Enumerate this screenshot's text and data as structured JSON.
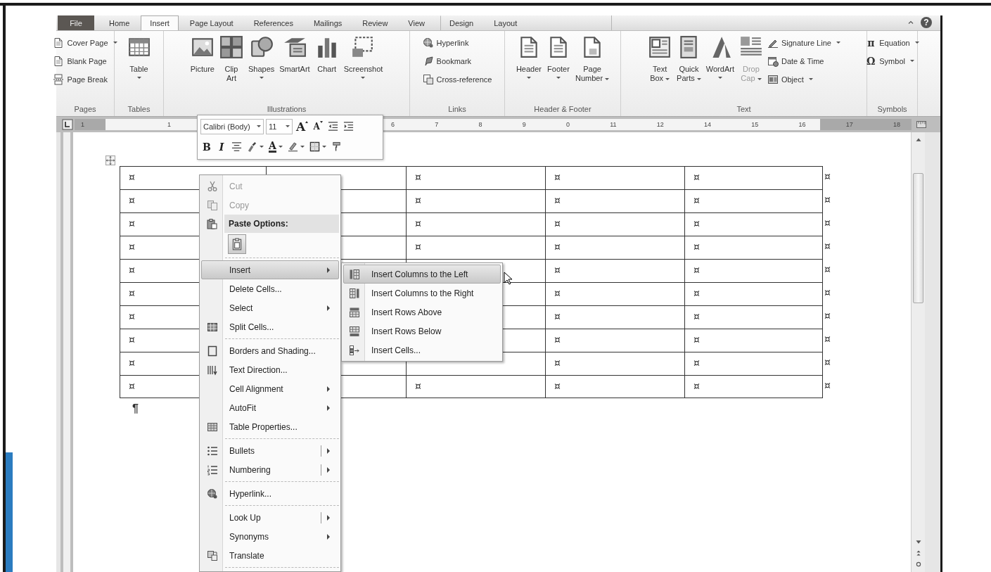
{
  "tabs": [
    {
      "label": "File",
      "kind": "file",
      "selected": false
    },
    {
      "label": "Home",
      "kind": "normal",
      "selected": false
    },
    {
      "label": "Insert",
      "kind": "normal",
      "selected": true
    },
    {
      "label": "Page Layout",
      "kind": "normal",
      "selected": false
    },
    {
      "label": "References",
      "kind": "normal",
      "selected": false
    },
    {
      "label": "Mailings",
      "kind": "normal",
      "selected": false
    },
    {
      "label": "Review",
      "kind": "normal",
      "selected": false
    },
    {
      "label": "View",
      "kind": "normal",
      "selected": false
    },
    {
      "label": "Design",
      "kind": "contextual",
      "selected": false
    },
    {
      "label": "Layout",
      "kind": "contextual",
      "selected": false
    }
  ],
  "help": "?",
  "ribbon_groups": [
    {
      "label": "Pages",
      "items": [
        {
          "kind": "small",
          "label": "Cover Page",
          "dropdown": true,
          "disabled": false
        },
        {
          "kind": "small",
          "label": "Blank Page",
          "dropdown": false,
          "disabled": false
        },
        {
          "kind": "small",
          "label": "Page Break",
          "dropdown": false,
          "disabled": false
        }
      ]
    },
    {
      "label": "Tables",
      "items": [
        {
          "kind": "large",
          "label": "Table",
          "dropdown": true,
          "disabled": false
        }
      ]
    },
    {
      "label": "Illustrations",
      "items": [
        {
          "kind": "large",
          "label": "Picture",
          "dropdown": false,
          "disabled": false
        },
        {
          "kind": "large",
          "label": "Clip\nArt",
          "dropdown": false,
          "disabled": false
        },
        {
          "kind": "large",
          "label": "Shapes",
          "dropdown": true,
          "disabled": false
        },
        {
          "kind": "large",
          "label": "SmartArt",
          "dropdown": false,
          "disabled": false
        },
        {
          "kind": "large",
          "label": "Chart",
          "dropdown": false,
          "disabled": false
        },
        {
          "kind": "large",
          "label": "Screenshot",
          "dropdown": true,
          "disabled": false
        }
      ]
    },
    {
      "label": "Links",
      "items": [
        {
          "kind": "small",
          "label": "Hyperlink",
          "dropdown": false,
          "disabled": false
        },
        {
          "kind": "small",
          "label": "Bookmark",
          "dropdown": false,
          "disabled": false
        },
        {
          "kind": "small",
          "label": "Cross-reference",
          "dropdown": false,
          "disabled": false
        }
      ]
    },
    {
      "label": "Header & Footer",
      "items": [
        {
          "kind": "large",
          "label": "Header",
          "dropdown": true,
          "disabled": false
        },
        {
          "kind": "large",
          "label": "Footer",
          "dropdown": true,
          "disabled": false
        },
        {
          "kind": "large",
          "label": "Page\nNumber",
          "dropdown": true,
          "disabled": false
        }
      ]
    },
    {
      "label": "Text",
      "items": [
        {
          "kind": "large",
          "label": "Text\nBox",
          "dropdown": true,
          "disabled": false
        },
        {
          "kind": "large",
          "label": "Quick\nParts",
          "dropdown": true,
          "disabled": false
        },
        {
          "kind": "large",
          "label": "WordArt",
          "dropdown": true,
          "disabled": false
        },
        {
          "kind": "large",
          "label": "Drop\nCap",
          "dropdown": true,
          "disabled": true
        },
        {
          "kind": "small",
          "label": "Signature Line",
          "dropdown": true,
          "disabled": false
        },
        {
          "kind": "small",
          "label": "Date & Time",
          "dropdown": false,
          "disabled": false
        },
        {
          "kind": "small",
          "label": "Object",
          "dropdown": true,
          "disabled": false
        }
      ]
    },
    {
      "label": "Symbols",
      "items": [
        {
          "kind": "small",
          "glyph": "π",
          "label": "Equation",
          "dropdown": true,
          "disabled": false
        },
        {
          "kind": "small",
          "glyph": "Ω",
          "label": "Symbol",
          "dropdown": true,
          "disabled": false
        }
      ]
    }
  ],
  "ruler": {
    "left_numbers": [
      "1",
      "1"
    ],
    "right_numbers": [
      "6",
      "7",
      "8",
      "9",
      "0",
      "11",
      "12",
      "14",
      "15",
      "16",
      "17",
      "18"
    ]
  },
  "mini_toolbar": {
    "font": "Calibri (Body)",
    "size": "11",
    "row1": [
      {
        "kind": "grow",
        "label": "A"
      },
      {
        "kind": "shrink",
        "label": "A"
      },
      {
        "kind": "outdent"
      },
      {
        "kind": "indent"
      }
    ],
    "row2": [
      {
        "kind": "bold",
        "label": "B"
      },
      {
        "kind": "italic",
        "label": "I"
      },
      {
        "kind": "center"
      },
      {
        "kind": "styles"
      },
      {
        "kind": "font_color",
        "label": "A"
      },
      {
        "kind": "highlight"
      },
      {
        "kind": "borders"
      },
      {
        "kind": "painter"
      }
    ]
  },
  "table": {
    "rows": [
      {
        "cells": [
          "¤",
          null,
          "¤",
          "¤",
          "¤"
        ],
        "end": "¤"
      },
      {
        "cells": [
          "¤",
          null,
          "¤",
          "¤",
          "¤"
        ],
        "end": "¤"
      },
      {
        "cells": [
          "¤",
          null,
          "¤",
          "¤",
          "¤"
        ],
        "end": "¤"
      },
      {
        "cells": [
          "¤",
          null,
          "¤",
          "¤",
          "¤"
        ],
        "end": "¤"
      },
      {
        "cells": [
          "¤",
          null,
          null,
          "¤",
          "¤"
        ],
        "end": "¤"
      },
      {
        "cells": [
          "¤",
          null,
          null,
          "¤",
          "¤"
        ],
        "end": "¤"
      },
      {
        "cells": [
          "¤",
          null,
          null,
          "¤",
          "¤"
        ],
        "end": "¤"
      },
      {
        "cells": [
          "¤",
          null,
          null,
          "¤",
          "¤"
        ],
        "end": "¤"
      },
      {
        "cells": [
          "¤",
          null,
          null,
          "¤",
          "¤"
        ],
        "end": "¤"
      },
      {
        "cells": [
          "¤",
          null,
          "¤",
          "¤",
          "¤"
        ],
        "end": "¤"
      }
    ]
  },
  "paragraph_mark": "¶",
  "context_menu": [
    {
      "kind": "item",
      "label": "Cut",
      "disabled": true,
      "selected": false,
      "submenu": false,
      "split": false
    },
    {
      "kind": "item",
      "label": "Copy",
      "disabled": true,
      "selected": false,
      "submenu": false,
      "split": false
    },
    {
      "kind": "header",
      "label": "Paste Options:"
    },
    {
      "kind": "paste_options"
    },
    {
      "kind": "separator"
    },
    {
      "kind": "item",
      "label": "Insert",
      "disabled": false,
      "selected": true,
      "submenu": true,
      "split": false
    },
    {
      "kind": "item",
      "label": "Delete Cells...",
      "disabled": false,
      "selected": false,
      "submenu": false,
      "split": false
    },
    {
      "kind": "item",
      "label": "Select",
      "disabled": false,
      "selected": false,
      "submenu": true,
      "split": false
    },
    {
      "kind": "item",
      "label": "Split Cells...",
      "disabled": false,
      "selected": false,
      "submenu": false,
      "split": false
    },
    {
      "kind": "separator"
    },
    {
      "kind": "item",
      "label": "Borders and Shading...",
      "disabled": false,
      "selected": false,
      "submenu": false,
      "split": false
    },
    {
      "kind": "item",
      "label": "Text Direction...",
      "disabled": false,
      "selected": false,
      "submenu": false,
      "split": false
    },
    {
      "kind": "item",
      "label": "Cell Alignment",
      "disabled": false,
      "selected": false,
      "submenu": true,
      "split": false
    },
    {
      "kind": "item",
      "label": "AutoFit",
      "disabled": false,
      "selected": false,
      "submenu": true,
      "split": false
    },
    {
      "kind": "item",
      "label": "Table Properties...",
      "disabled": false,
      "selected": false,
      "submenu": false,
      "split": false
    },
    {
      "kind": "separator"
    },
    {
      "kind": "item",
      "label": "Bullets",
      "disabled": false,
      "selected": false,
      "submenu": true,
      "split": true
    },
    {
      "kind": "item",
      "label": "Numbering",
      "disabled": false,
      "selected": false,
      "submenu": true,
      "split": true
    },
    {
      "kind": "separator"
    },
    {
      "kind": "item",
      "label": "Hyperlink...",
      "disabled": false,
      "selected": false,
      "submenu": false,
      "split": false
    },
    {
      "kind": "separator"
    },
    {
      "kind": "item",
      "label": "Look Up",
      "disabled": false,
      "selected": false,
      "submenu": true,
      "split": true
    },
    {
      "kind": "item",
      "label": "Synonyms",
      "disabled": false,
      "selected": false,
      "submenu": true,
      "split": false
    },
    {
      "kind": "item",
      "label": "Translate",
      "disabled": false,
      "selected": false,
      "submenu": false,
      "split": false
    },
    {
      "kind": "separator"
    }
  ],
  "submenu": [
    {
      "label": "Insert Columns to the Left",
      "selected": true
    },
    {
      "label": "Insert Columns to the Right",
      "selected": false
    },
    {
      "label": "Insert Rows Above",
      "selected": false
    },
    {
      "label": "Insert Rows Below",
      "selected": false
    },
    {
      "label": "Insert Cells...",
      "selected": false
    }
  ]
}
